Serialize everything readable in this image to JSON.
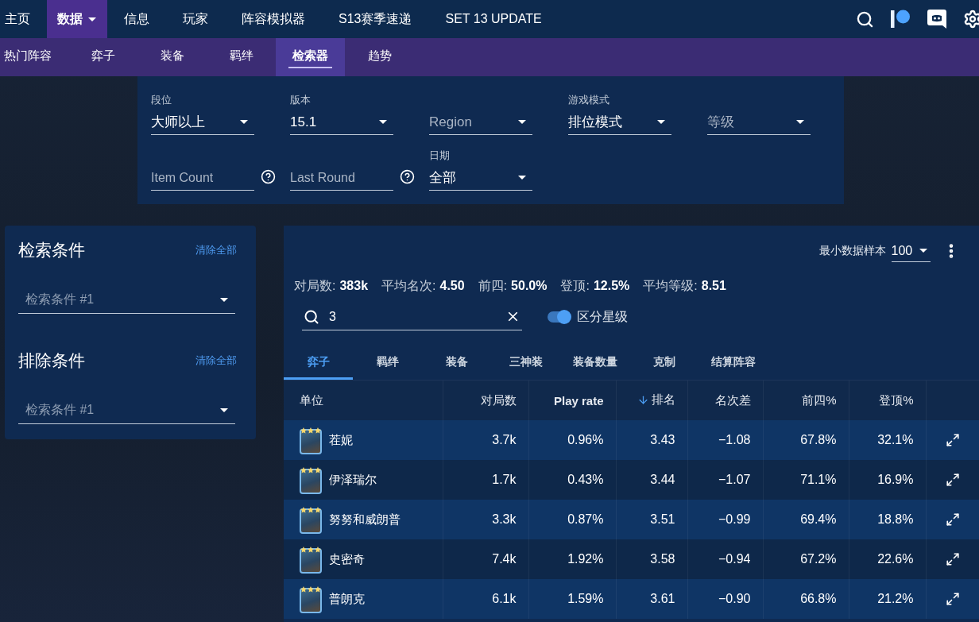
{
  "nav": {
    "items": [
      {
        "label": "主页",
        "selected": false,
        "has_menu": false
      },
      {
        "label": "数据",
        "selected": true,
        "has_menu": true
      },
      {
        "label": "信息",
        "selected": false,
        "has_menu": false
      },
      {
        "label": "玩家",
        "selected": false,
        "has_menu": false
      },
      {
        "label": "阵容模拟器",
        "selected": false,
        "has_menu": false
      },
      {
        "label": "S13赛季速递",
        "selected": false,
        "has_menu": false
      },
      {
        "label": "SET 13 UPDATE",
        "selected": false,
        "has_menu": false
      }
    ]
  },
  "subnav": {
    "items": [
      {
        "label": "热门阵容",
        "selected": false
      },
      {
        "label": "弈子",
        "selected": false
      },
      {
        "label": "装备",
        "selected": false
      },
      {
        "label": "羁绊",
        "selected": false
      },
      {
        "label": "检索器",
        "selected": true
      },
      {
        "label": "趋势",
        "selected": false
      }
    ]
  },
  "filters": [
    {
      "kind": "select",
      "label": "段位",
      "value": "大师以上"
    },
    {
      "kind": "select",
      "label": "版本",
      "value": "15.1"
    },
    {
      "kind": "select",
      "placeholder": "Region"
    },
    {
      "kind": "select",
      "label": "游戏模式",
      "value": "排位模式"
    },
    {
      "kind": "select",
      "placeholder": "等级"
    },
    {
      "kind": "number",
      "placeholder": "Item Count"
    },
    {
      "kind": "number",
      "placeholder": "Last Round"
    },
    {
      "kind": "select",
      "label": "日期",
      "value": "全部"
    }
  ],
  "criteria_panel": {
    "sections": [
      {
        "title": "检索条件",
        "action": "清除全部",
        "placeholder": "检索条件 #1"
      },
      {
        "title": "排除条件",
        "action": "清除全部",
        "placeholder": "检索条件 #1"
      }
    ]
  },
  "results": {
    "sample_size": {
      "label": "最小数据样本",
      "value": "100"
    },
    "stats": [
      {
        "label": "对局数:",
        "value": "383k"
      },
      {
        "label": "平均名次:",
        "value": "4.50"
      },
      {
        "label": "前四:",
        "value": "50.0%"
      },
      {
        "label": "登顶:",
        "value": "12.5%"
      },
      {
        "label": "平均等级:",
        "value": "8.51"
      }
    ],
    "search": {
      "value": "3"
    },
    "star_toggle": {
      "label": "区分星级",
      "on": true
    },
    "tabs": [
      {
        "label": "弈子",
        "selected": true
      },
      {
        "label": "羁绊",
        "selected": false
      },
      {
        "label": "装备",
        "selected": false
      },
      {
        "label": "三神装",
        "selected": false
      },
      {
        "label": "装备数量",
        "selected": false
      },
      {
        "label": "克制",
        "selected": false
      },
      {
        "label": "结算阵容",
        "selected": false
      }
    ],
    "table": {
      "columns": [
        {
          "label": "单位",
          "emphasized": false,
          "sorted": false
        },
        {
          "label": "对局数",
          "emphasized": false,
          "sorted": false
        },
        {
          "label": "Play rate",
          "emphasized": true,
          "sorted": false
        },
        {
          "label": "排名",
          "emphasized": false,
          "sorted": true
        },
        {
          "label": "名次差",
          "emphasized": false,
          "sorted": false
        },
        {
          "label": "前四%",
          "emphasized": false,
          "sorted": false
        },
        {
          "label": "登顶%",
          "emphasized": false,
          "sorted": false
        }
      ],
      "rows": [
        {
          "stars": 3,
          "cells": [
            "茬妮",
            "3.7k",
            "0.96%",
            "3.43",
            "−1.08",
            "67.8%",
            "32.1%"
          ]
        },
        {
          "stars": 3,
          "cells": [
            "伊泽瑞尔",
            "1.7k",
            "0.43%",
            "3.44",
            "−1.07",
            "71.1%",
            "16.9%"
          ]
        },
        {
          "stars": 3,
          "cells": [
            "努努和威朗普",
            "3.3k",
            "0.87%",
            "3.51",
            "−0.99",
            "69.4%",
            "18.8%"
          ]
        },
        {
          "stars": 3,
          "cells": [
            "史密奇",
            "7.4k",
            "1.92%",
            "3.58",
            "−0.94",
            "67.2%",
            "22.6%"
          ]
        },
        {
          "stars": 3,
          "cells": [
            "普朗克",
            "6.1k",
            "1.59%",
            "3.61",
            "−0.90",
            "66.8%",
            "21.2%"
          ]
        }
      ]
    }
  }
}
